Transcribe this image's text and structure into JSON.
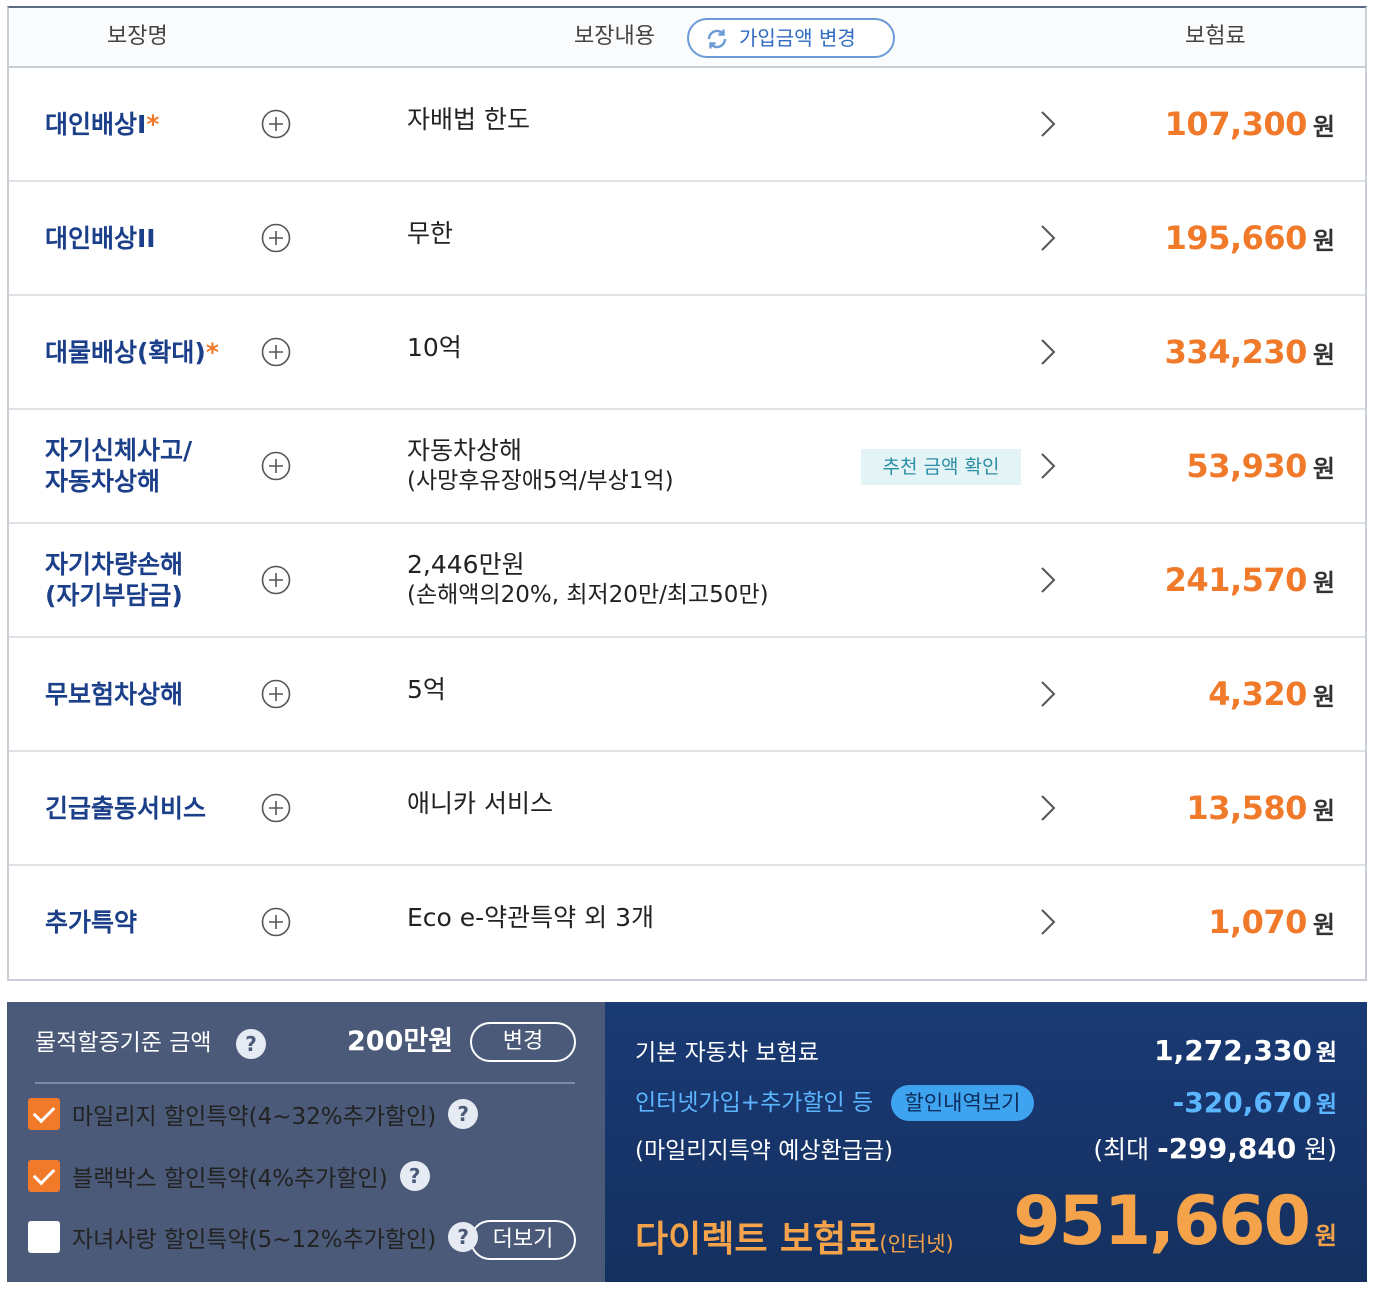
{
  "header": {
    "col_name": "보장명",
    "col_content": "보장내용",
    "change_button": "가입금액 변경",
    "col_premium": "보험료"
  },
  "rows": [
    {
      "name": "대인배상I",
      "required": "*",
      "content": "자배법 한도",
      "premium": "107,300"
    },
    {
      "name": "대인배상II",
      "required": "",
      "content": "무한",
      "premium": "195,660"
    },
    {
      "name": "대물배상(확대)",
      "required": "*",
      "content": "10억",
      "premium": "334,230"
    },
    {
      "name1": "자기신체사고/",
      "name2": "자동차상해",
      "content": "자동차상해",
      "content_sub": "(사망후유장애5억/부상1억)",
      "recommend": "추천 금액 확인",
      "premium": "53,930"
    },
    {
      "name1": "자기차량손해",
      "name2": "(자기부담금)",
      "content": "2,446만원",
      "content_sub": "(손해액의20%, 최저20만/최고50만)",
      "premium": "241,570"
    },
    {
      "name": "무보험차상해",
      "required": "",
      "content": "5억",
      "premium": "4,320"
    },
    {
      "name": "긴급출동서비스",
      "required": "",
      "content": "애니카 서비스",
      "premium": "13,580"
    },
    {
      "name": "추가특약",
      "required": "",
      "content": "Eco e-약관특약 외 3개",
      "premium": "1,070"
    }
  ],
  "currency": "원",
  "left_panel": {
    "threshold_label": "물적할증기준 금액",
    "threshold_value": "200만원",
    "change_button": "변경",
    "options": [
      {
        "label": "마일리지 할인특약(4~32%추가할인)",
        "checked": true
      },
      {
        "label": "블랙박스 할인특약(4%추가할인)",
        "checked": true
      },
      {
        "label": "자녀사랑 할인특약(5~12%추가할인)",
        "checked": false
      }
    ],
    "more_button": "더보기",
    "help": "?"
  },
  "right_panel": {
    "base_label": "기본 자동차 보험료",
    "base_value": "1,272,330",
    "discount_label": "인터넷가입+추가할인 등",
    "discount_button": "할인내역보기",
    "discount_value": "-320,670",
    "mileage_label": "(마일리지특약 예상환급금)",
    "mileage_prefix": "(최대",
    "mileage_value": "-299,840",
    "mileage_suffix": "원)",
    "final_label": "다이렉트 보험료",
    "final_label_small": "(인터넷)",
    "final_value": "951,660"
  },
  "colors": {
    "accent_orange": "#f07a2a",
    "name_blue": "#1c3f8a",
    "panel_dark": "#4a5a78",
    "panel_navy": "#1a3a75"
  }
}
